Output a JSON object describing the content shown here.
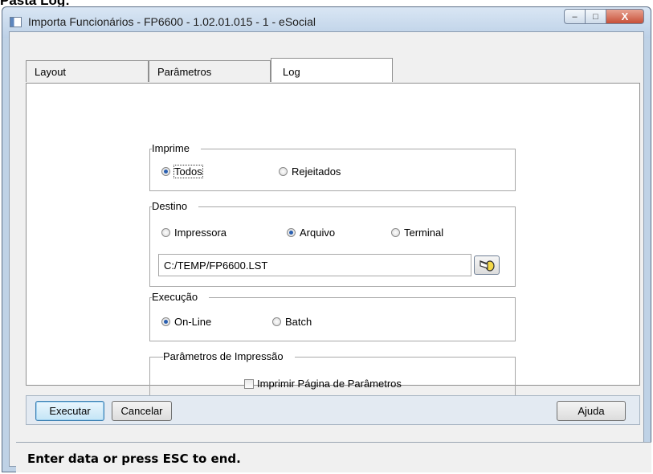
{
  "heading": "Pasta Log:",
  "window": {
    "title": "Importa Funcionários - FP6600 - 1.02.01.015 - 1 - eSocial",
    "controls": {
      "minimize": "–",
      "maximize": "□",
      "close": "X"
    }
  },
  "tabs": [
    {
      "label": "Layout"
    },
    {
      "label": "Parâmetros"
    },
    {
      "label": "Log",
      "active": true
    }
  ],
  "imprime": {
    "legend": "Imprime",
    "options": [
      {
        "label": "Todos",
        "selected": true
      },
      {
        "label": "Rejeitados",
        "selected": false
      }
    ]
  },
  "destino": {
    "legend": "Destino",
    "options": [
      {
        "label": "Impressora",
        "selected": false
      },
      {
        "label": "Arquivo",
        "selected": true
      },
      {
        "label": "Terminal",
        "selected": false
      }
    ],
    "file_path": "C:/TEMP/FP6600.LST"
  },
  "execucao": {
    "legend": "Execução",
    "options": [
      {
        "label": "On-Line",
        "selected": true
      },
      {
        "label": "Batch",
        "selected": false
      }
    ]
  },
  "parametros_impressao": {
    "legend": "Parâmetros de Impressão",
    "checkbox_label": "Imprimir Página de Parâmetros",
    "checked": false
  },
  "buttons": {
    "executar": "Executar",
    "cancelar": "Cancelar",
    "ajuda": "Ajuda"
  },
  "status": "Enter data or press ESC to end.",
  "colors": {
    "accent": "#2a5fb0",
    "title_bar": "#bdd1e7",
    "close_button": "#c75038"
  }
}
